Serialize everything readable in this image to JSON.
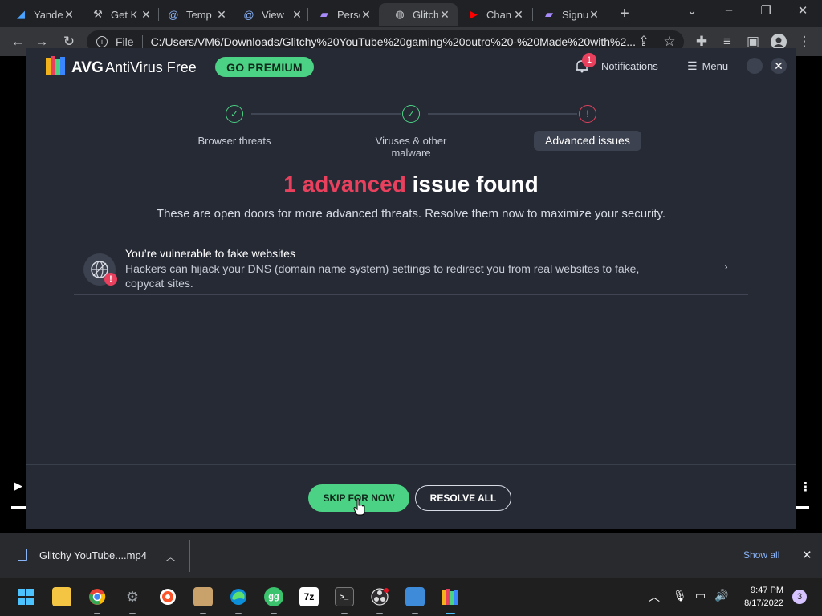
{
  "browser": {
    "tabs": [
      {
        "title": "Yande",
        "icon": "yandex-icon"
      },
      {
        "title": "Get K",
        "icon": "tool-icon"
      },
      {
        "title": "Temp",
        "icon": "at-icon"
      },
      {
        "title": "View",
        "icon": "at-icon"
      },
      {
        "title": "Perso",
        "icon": "purple-folder-icon"
      },
      {
        "title": "Glitch",
        "icon": "globe-icon"
      },
      {
        "title": "Chan",
        "icon": "youtube-icon"
      },
      {
        "title": "Signu",
        "icon": "purple-folder-icon"
      }
    ],
    "omnibox": {
      "scheme_label": "File",
      "url": "C:/Users/VM6/Downloads/Glitchy%20YouTube%20gaming%20outro%20-%20Made%20with%2..."
    }
  },
  "avg": {
    "brand": "AVG",
    "product": "AntiVirus Free",
    "premium_label": "GO PREMIUM",
    "notifications": {
      "count": "1",
      "label": "Notifications"
    },
    "menu_label": "Menu",
    "steps": [
      {
        "label": "Browser threats",
        "state": "done"
      },
      {
        "label": "Viruses & other malware",
        "state": "done"
      },
      {
        "label": "Advanced issues",
        "state": "warn"
      }
    ],
    "headline": {
      "highlight": "1 advanced",
      "rest": "issue found"
    },
    "subline": "These are open doors for more advanced threats. Resolve them now to maximize your security.",
    "issue": {
      "title": "You’re vulnerable to fake websites",
      "description": "Hackers can hijack your DNS (domain name system) settings to redirect you from real websites to fake, copycat sites."
    },
    "buttons": {
      "skip": "SKIP FOR NOW",
      "resolve": "RESOLVE ALL"
    },
    "colors": {
      "accent_green": "#4bd284",
      "alert_red": "#e8405d",
      "background": "#262a35"
    }
  },
  "download_bar": {
    "file_name": "Glitchy YouTube....mp4",
    "show_all": "Show all"
  },
  "taskbar": {
    "apps": [
      "windows-start",
      "file-explorer",
      "chrome",
      "settings",
      "brave",
      "app-store",
      "edge",
      "gg-app",
      "7zip",
      "terminal",
      "obs",
      "notepad",
      "avg"
    ],
    "time": "9:47 PM",
    "date": "8/17/2022",
    "notification_count": "3"
  }
}
